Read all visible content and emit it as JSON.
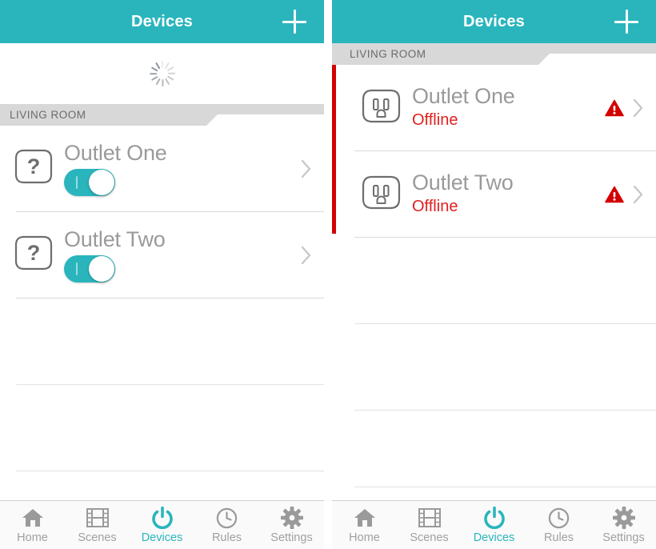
{
  "accent_color": "#2ab5bd",
  "alert_color": "#d40000",
  "offline_color": "#e02020",
  "label_gray": "#9a9a9a",
  "screens": [
    {
      "id": "loading-screen",
      "navbar": {
        "title": "Devices",
        "add_icon": "plus-icon"
      },
      "loading": {
        "visible": true,
        "spinner_icon": "loading-spinner-icon"
      },
      "section": {
        "label": "LIVING ROOM"
      },
      "alert_bar": false,
      "rows": [
        {
          "name": "Outlet One",
          "icon": "unknown-device-icon",
          "status": "",
          "toggle": {
            "state": "on",
            "mark": "I"
          },
          "chevron": "chevron-right-icon",
          "warning": false
        },
        {
          "name": "Outlet Two",
          "icon": "unknown-device-icon",
          "status": "",
          "toggle": {
            "state": "on",
            "mark": "I"
          },
          "chevron": "chevron-right-icon",
          "warning": false
        }
      ],
      "empty_row_count": 3
    },
    {
      "id": "offline-screen",
      "navbar": {
        "title": "Devices",
        "add_icon": "plus-icon"
      },
      "loading": {
        "visible": false,
        "spinner_icon": "loading-spinner-icon"
      },
      "section": {
        "label": "LIVING ROOM"
      },
      "alert_bar": true,
      "rows": [
        {
          "name": "Outlet One",
          "icon": "power-outlet-icon",
          "status": "Offline",
          "toggle": null,
          "chevron": "chevron-right-icon",
          "warning": true,
          "warning_icon": "warning-triangle-icon"
        },
        {
          "name": "Outlet Two",
          "icon": "power-outlet-icon",
          "status": "Offline",
          "toggle": null,
          "chevron": "chevron-right-icon",
          "warning": true,
          "warning_icon": "warning-triangle-icon"
        }
      ],
      "empty_row_count": 3
    }
  ],
  "tabbar": {
    "items": [
      {
        "label": "Home",
        "icon": "home-icon",
        "active": false
      },
      {
        "label": "Scenes",
        "icon": "film-icon",
        "active": false
      },
      {
        "label": "Devices",
        "icon": "power-icon",
        "active": true
      },
      {
        "label": "Rules",
        "icon": "clock-icon",
        "active": false
      },
      {
        "label": "Settings",
        "icon": "gear-icon",
        "active": false
      }
    ]
  }
}
